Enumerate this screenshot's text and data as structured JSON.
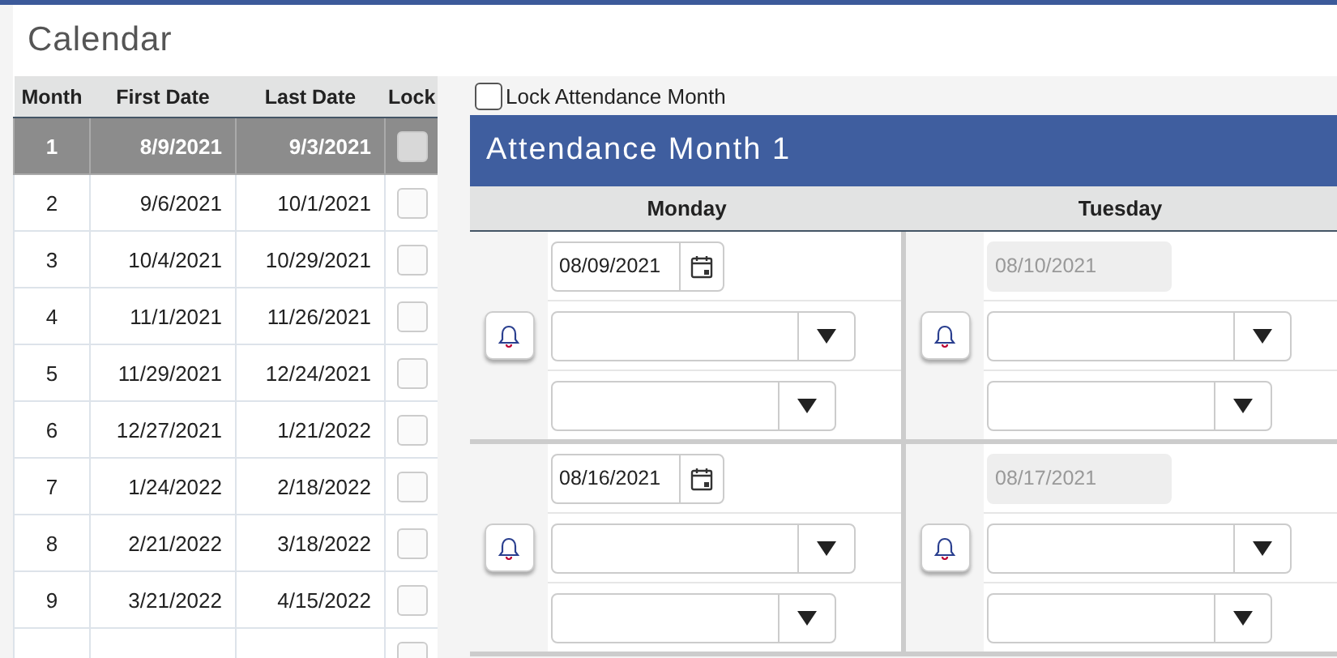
{
  "page": {
    "title": "Calendar"
  },
  "months_table": {
    "columns": [
      "Month",
      "First Date",
      "Last Date",
      "Lock"
    ],
    "rows": [
      {
        "month": "1",
        "first_date": "8/9/2021",
        "last_date": "9/3/2021",
        "locked": false,
        "selected": true
      },
      {
        "month": "2",
        "first_date": "9/6/2021",
        "last_date": "10/1/2021",
        "locked": false,
        "selected": false
      },
      {
        "month": "3",
        "first_date": "10/4/2021",
        "last_date": "10/29/2021",
        "locked": false,
        "selected": false
      },
      {
        "month": "4",
        "first_date": "11/1/2021",
        "last_date": "11/26/2021",
        "locked": false,
        "selected": false
      },
      {
        "month": "5",
        "first_date": "11/29/2021",
        "last_date": "12/24/2021",
        "locked": false,
        "selected": false
      },
      {
        "month": "6",
        "first_date": "12/27/2021",
        "last_date": "1/21/2022",
        "locked": false,
        "selected": false
      },
      {
        "month": "7",
        "first_date": "1/24/2022",
        "last_date": "2/18/2022",
        "locked": false,
        "selected": false
      },
      {
        "month": "8",
        "first_date": "2/21/2022",
        "last_date": "3/18/2022",
        "locked": false,
        "selected": false
      },
      {
        "month": "9",
        "first_date": "3/21/2022",
        "last_date": "4/15/2022",
        "locked": false,
        "selected": false
      },
      {
        "locked": false,
        "selected": false
      }
    ]
  },
  "lock_month": {
    "label": "Lock Attendance Month",
    "checked": false
  },
  "attendance": {
    "title": "Attendance Month 1",
    "days": [
      "Monday",
      "Tuesday"
    ],
    "weeks": [
      [
        {
          "date": "08/09/2021",
          "disabled": false
        },
        {
          "date": "08/10/2021",
          "disabled": true
        }
      ],
      [
        {
          "date": "08/16/2021",
          "disabled": false
        },
        {
          "date": "08/17/2021",
          "disabled": true
        }
      ]
    ]
  }
}
